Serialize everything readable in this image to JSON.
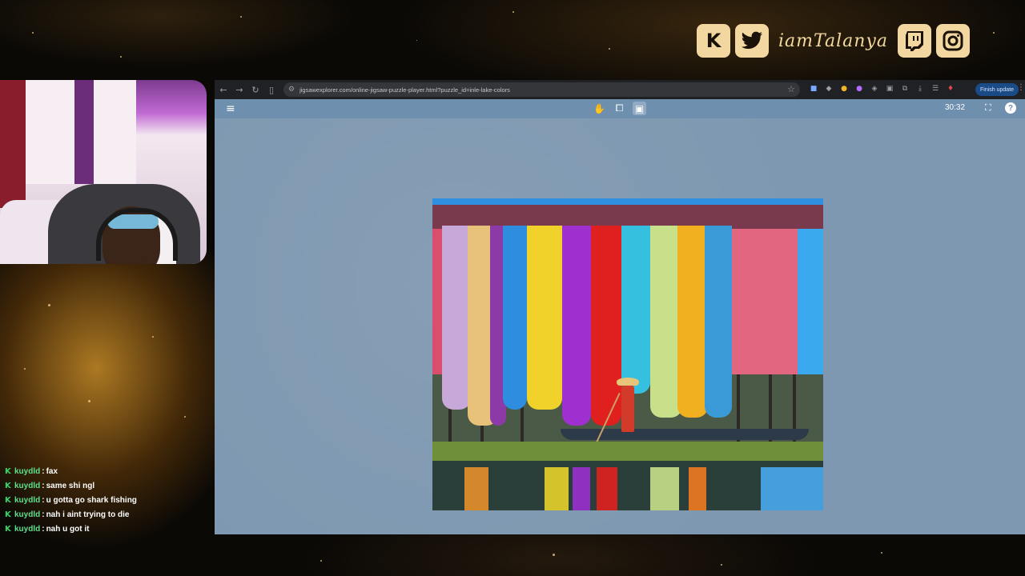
{
  "overlay": {
    "social": {
      "icons": [
        "kick-icon",
        "twitter-icon",
        "twitch-icon",
        "instagram-icon"
      ],
      "kick_glyph": "K",
      "handle": "iamTalanya",
      "accent": "#f2d8a0"
    },
    "chat": {
      "badge_color": "#38d46a",
      "messages": [
        {
          "user": "kuydld",
          "text": "fax"
        },
        {
          "user": "kuydld",
          "text": "same shi ngl"
        },
        {
          "user": "kuydld",
          "text": "u gotta go shark fishing"
        },
        {
          "user": "kuydld",
          "text": "nah i aint trying to die"
        },
        {
          "user": "kuydld",
          "text": "nah u got it"
        }
      ]
    }
  },
  "browser": {
    "url": "jigsawexplorer.com/online-jigsaw-puzzle-player.html?puzzle_id=inle-lake-colors",
    "finish_update_label": "Finish update",
    "theme_color": "#202124"
  },
  "puzzle_app": {
    "timer": "30:32",
    "toolbar_color": "#6f8fae",
    "board_color": "#7e98b1",
    "help_glyph": "?"
  }
}
